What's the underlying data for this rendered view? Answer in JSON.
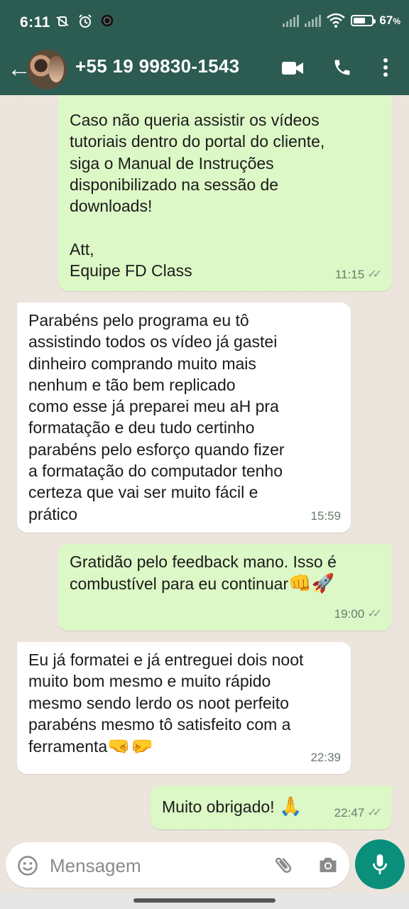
{
  "status_bar": {
    "time": "6:11",
    "battery": "67",
    "battery_unit": "%",
    "battery_level": 0.67
  },
  "header": {
    "back_icon": "arrow-left-icon",
    "contact_name": "+55 19 99830-1543",
    "icons": [
      "video-call-icon",
      "phone-icon",
      "more-vert-icon"
    ]
  },
  "messages": [
    {
      "dir": "out",
      "text": "Caso não queria assistir os vídeos\ntutoriais dentro do portal do cliente,\nsiga o Manual de Instruções\ndisponibilizado na sessão de\ndownloads!\n\nAtt,\nEquipe FD Class",
      "time": "11:15",
      "read": true
    },
    {
      "dir": "in",
      "text": "Parabéns pelo programa eu tô\nassistindo todos os vídeo já gastei\ndinheiro comprando muito mais\nnenhum e tão bem replicado\ncomo esse já preparei meu aH pra\nformatação e deu tudo certinho\nparabéns pelo esforço quando fizer\na formatação do computador tenho\ncerteza que vai ser muito fácil e\nprático",
      "time": "15:59"
    },
    {
      "dir": "out",
      "text": "Gratidão pelo feedback mano. Isso é\ncombustível para eu continuar",
      "emoji": "👊🚀",
      "time": "19:00",
      "read": true
    },
    {
      "dir": "in",
      "text": "Eu já formatei e já entreguei dois noot\nmuito bom mesmo e muito rápido\nmesmo sendo lerdo os noot perfeito\nparabéns mesmo tô satisfeito com a\nferramenta",
      "emoji": "🤜🤛",
      "time": "22:39"
    },
    {
      "dir": "out",
      "text": "Muito obrigado!",
      "emoji": "🙏",
      "time": "22:47",
      "read": true
    }
  ],
  "input": {
    "placeholder": "Mensagem",
    "icons": [
      "emoji-icon",
      "attach-icon",
      "camera-icon",
      "mic-icon"
    ]
  },
  "colors": {
    "header": "#2c5b52",
    "outgoing_bubble": "#dcf8c6",
    "incoming_bubble": "#ffffff",
    "mic_button": "#0a8f7a"
  }
}
